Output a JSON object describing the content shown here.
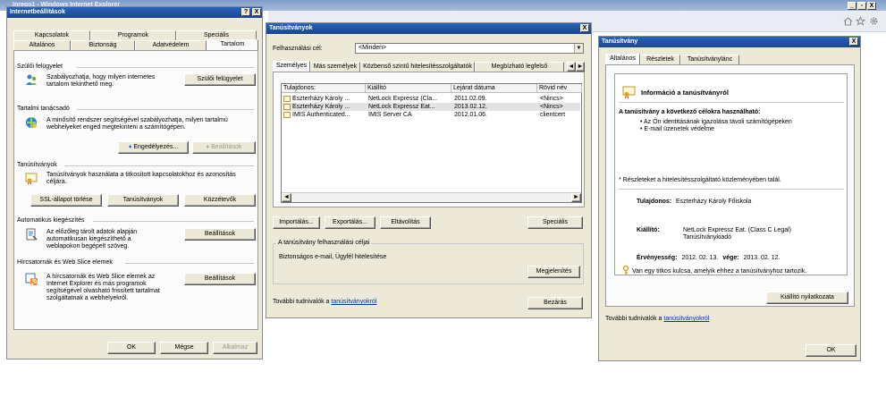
{
  "ie": {
    "title": "Inrego1 - Windows Internet Explorer",
    "controls": {
      "min": "_",
      "max": "▫",
      "close": "X"
    },
    "toolbar_icons": [
      "home-icon",
      "favorites-star-icon",
      "tools-gear-icon"
    ]
  },
  "internet_options": {
    "title": "Internetbeállítások",
    "help": "?",
    "close": "X",
    "tabs_top": [
      "Kapcsolatok",
      "Programok",
      "Speciális"
    ],
    "tabs_bottom": [
      "Általános",
      "Biztonság",
      "Adatvédelem",
      "Tartalom"
    ],
    "parental": {
      "header": "Szülői felügyelet",
      "text": "Szabályozhatja, hogy milyen internetes tartalom tekinthető meg.",
      "button": "Szülői felügyelet"
    },
    "advisor": {
      "header": "Tartalmi tanácsadó",
      "text": "A minősítő rendszer segítségével szabályozhatja, milyen tartalmú webhelyeket enged megtekinteni a számítógépen.",
      "enable_button": "Engedélyezés...",
      "settings_button": "Beállítások"
    },
    "certificates": {
      "header": "Tanúsítványok",
      "text": "Tanúsítványok használata a titkosított kapcsolatokhoz és azonosítás céljára.",
      "ssl_button": "SSL-állapot törlése",
      "certs_button": "Tanúsítványok",
      "publishers_button": "Közzétevők"
    },
    "autocomplete": {
      "header": "Automatikus kiegészítés",
      "text": "Az előzőleg tárolt adatok alapján automatikusan kiegészíthető a weblapokon begépelt szöveg.",
      "button": "Beállítások"
    },
    "feeds": {
      "header": "Hírcsatornák és Web Slice elemek",
      "text": "A hírcsatornák és Web Slice elemek az Internet Explorer és más programok segítségével olvasható frissített tartalmat szolgáltatnak a webhelyekről.",
      "button": "Beállítások"
    },
    "footer": {
      "ok": "OK",
      "cancel": "Mégse",
      "apply": "Alkalmaz"
    }
  },
  "certificates_dialog": {
    "title": "Tanúsítványok",
    "close": "X",
    "purpose_label": "Felhasználási cél:",
    "purpose_value": "<Minden>",
    "tabs": [
      "Személyes",
      "Más személyek",
      "Közbenső szintű hitelesítésszolgáltatók",
      "Megbízható legfelső"
    ],
    "columns": [
      "Tulajdonos:",
      "Kiállító",
      "Lejárat dátuma",
      "Rövid név"
    ],
    "rows": [
      {
        "owner": "Eszterházy Károly ...",
        "issuer": "NetLock Expressz (Cla...",
        "expires": "2011.02.09.",
        "short": "<Nincs>"
      },
      {
        "owner": "Eszterházy Károly ...",
        "issuer": "NetLock Expressz Eat...",
        "expires": "2013.02.12.",
        "short": "<Nincs>"
      },
      {
        "owner": "IMIS Authenticated...",
        "issuer": "IMIS Server CA",
        "expires": "2012.01.06.",
        "short": "clientcert"
      }
    ],
    "import_button": "Importálás...",
    "export_button": "Exportálás...",
    "remove_button": "Eltávolítás",
    "advanced_button": "Speciális",
    "purposes_header": "A tanúsítvány felhasználási céljai",
    "purposes_value": "Biztonságos e-mail, Ügyfél hitelesítése",
    "view_button": "Megjelenítés",
    "more_info_prefix": "További tudnivalók a ",
    "more_info_link": "tanúsítványokról",
    "close_button": "Bezárás"
  },
  "certificate_dialog": {
    "title": "Tanúsítvány",
    "close": "X",
    "tabs": [
      "Általános",
      "Részletek",
      "Tanúsítványlánc"
    ],
    "info_title": "Információ a tanúsítványról",
    "purpose_title": "A tanúsítvány a következő célokra használható:",
    "purposes": [
      "Az Ön identitásának igazolása távoli számítógépeken",
      "E-mail üzenetek védelme"
    ],
    "issuer_statement_note": "* Részleteket a hitelesítésszolgáltató közleményében talál.",
    "owner_label": "Tulajdonos:",
    "owner_value": "Eszterházy Károly Főiskola",
    "issuer_label": "Kiállító:",
    "issuer_value_1": "NetLock Expressz Eat. (Class C Legal)",
    "issuer_value_2": "Tanúsítványkiadó",
    "validity_label": "Érvényesség:",
    "validity_from": "2012. 02. 13.",
    "validity_to_label": "vége:",
    "validity_to": "2013. 02. 12.",
    "key_note": "Van egy titkos kulcsa, amelyik ehhez a tanúsítványhoz tartozik.",
    "issuer_statement_button": "Kiállító nyilatkozata",
    "more_info_prefix": "További tudnivalók a ",
    "more_info_link": "tanúsítványokról",
    "ok_button": "OK"
  },
  "colors": {
    "title_blue": "#1d4e9f",
    "dialog_face": "#ece9d8",
    "link": "#0033aa"
  }
}
